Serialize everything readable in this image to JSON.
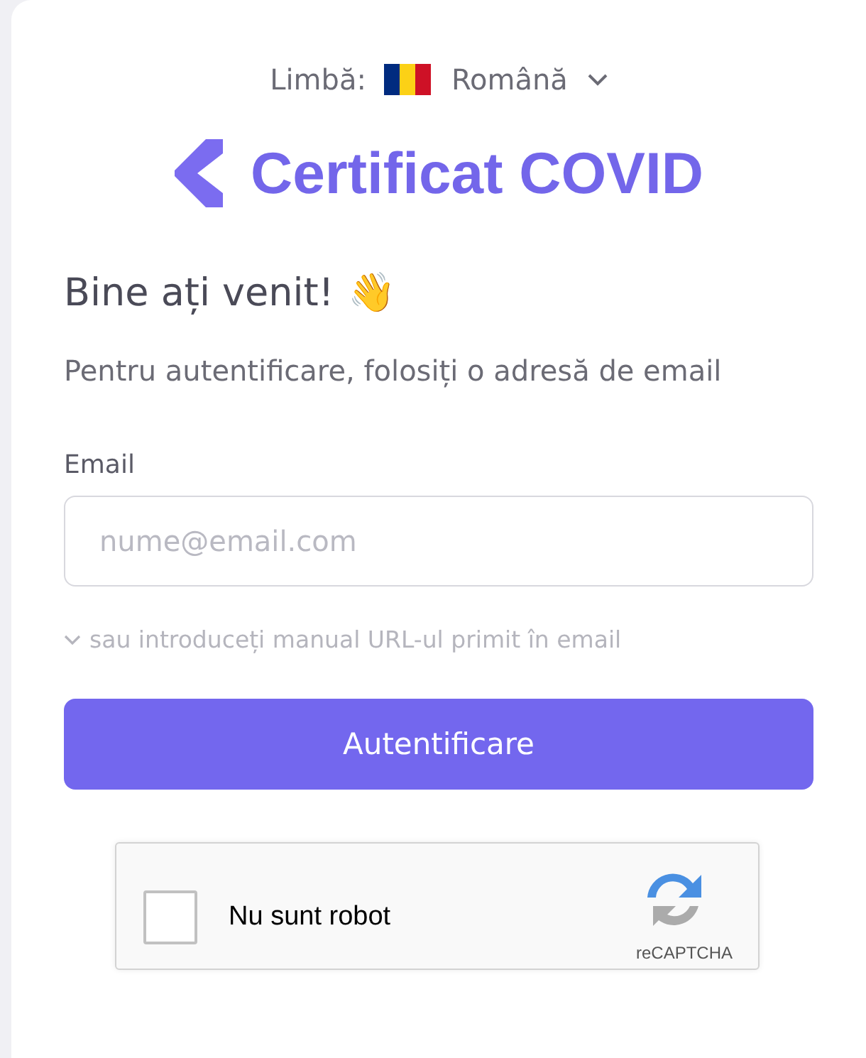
{
  "language": {
    "label": "Limbă:",
    "value": "Română"
  },
  "brand": {
    "title": "Certificat COVID"
  },
  "welcome": {
    "heading": "Bine ați venit!",
    "emoji": "👋"
  },
  "intro": "Pentru autentificare, folosiți o adresă de email",
  "email": {
    "label": "Email",
    "placeholder": "nume@email.com"
  },
  "manual_link": {
    "text": "sau introduceți manual URL-ul primit în email",
    "expanded": false
  },
  "submit": "Autentificare",
  "captcha": {
    "label": "Nu sunt robot",
    "checked": false,
    "brand": "reCAPTCHA"
  }
}
